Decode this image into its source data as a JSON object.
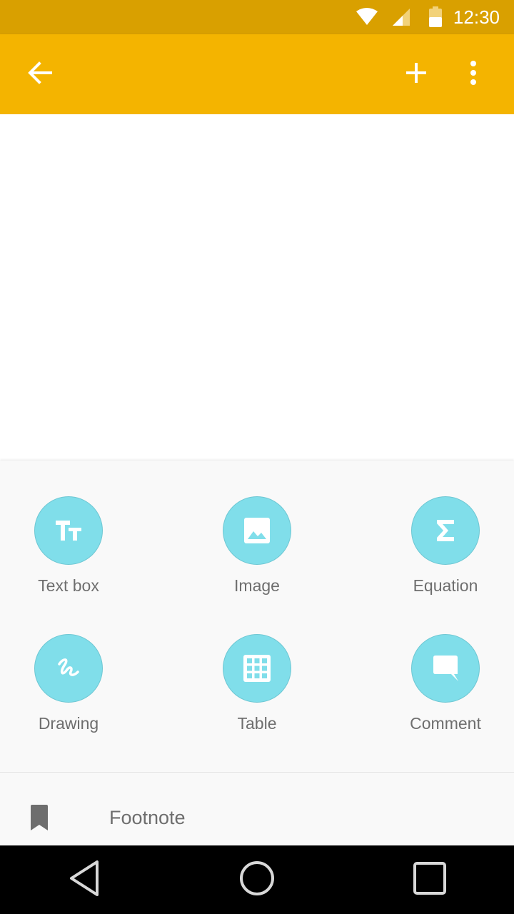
{
  "status_bar": {
    "time": "12:30",
    "icons": [
      "wifi-icon",
      "cellular-signal-icon",
      "battery-icon"
    ]
  },
  "app_bar": {
    "background": "#f4b400",
    "icons": [
      "back-arrow-icon",
      "add-icon",
      "more-vert-icon"
    ]
  },
  "insert_menu": {
    "accent": "#80deea",
    "items": [
      {
        "label": "Text box",
        "icon": "text-format-icon"
      },
      {
        "label": "Image",
        "icon": "image-icon"
      },
      {
        "label": "Equation",
        "icon": "sigma-icon"
      },
      {
        "label": "Drawing",
        "icon": "scribble-icon"
      },
      {
        "label": "Table",
        "icon": "table-grid-icon"
      },
      {
        "label": "Comment",
        "icon": "comment-icon"
      }
    ],
    "footnote": {
      "label": "Footnote",
      "icon": "bookmark-icon"
    }
  },
  "nav_bar": {
    "icons": [
      "back-triangle-icon",
      "home-circle-icon",
      "recents-square-icon"
    ]
  }
}
